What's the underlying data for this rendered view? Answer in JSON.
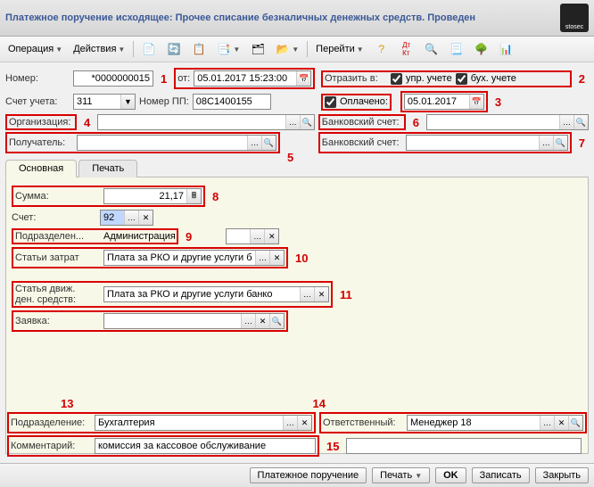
{
  "window": {
    "title": "Платежное поручение исходящее: Прочее списание безналичных денежных средств. Проведен"
  },
  "toolbar": {
    "operation_label": "Операция",
    "actions_label": "Действия",
    "goto_label": "Перейти"
  },
  "header": {
    "number_label": "Номер:",
    "number_value": "*0000000015",
    "date_label": "от:",
    "date_value": "05.01.2017 15:23:00",
    "reflect_label": "Отразить в:",
    "upr_label": "упр. учете",
    "bukh_label": "бух. учете",
    "account_label": "Счет учета:",
    "account_value": "311",
    "pp_label": "Номер ПП:",
    "pp_value": "08C1400155",
    "paid_label": "Оплачено:",
    "paid_value": "05.01.2017",
    "org_label": "Организация:",
    "org_value": "",
    "bank1_label": "Банковский счет:",
    "bank1_value": "",
    "recipient_label": "Получатель:",
    "recipient_value": "",
    "bank2_label": "Банковский счет:",
    "bank2_value": ""
  },
  "tabs": {
    "main_label": "Основная",
    "print_label": "Печать"
  },
  "main": {
    "sum_label": "Сумма:",
    "sum_value": "21,17",
    "acc_label": "Счет:",
    "acc_value": "92",
    "subdiv_label": "Подразделен...",
    "subdiv_value": "Администрация",
    "cost_label": "Статьи затрат",
    "cost_value": "Плата за РКО и другие услуги банко",
    "cash_move_label1": "Статья движ.",
    "cash_move_label2": "ден. средств:",
    "cash_move_value": "Плата за РКО и другие услуги банко",
    "request_label": "Заявка:",
    "request_value": ""
  },
  "bottom": {
    "subdiv_label": "Подразделение:",
    "subdiv_value": "Бухгалтерия",
    "resp_label": "Ответственный:",
    "resp_value": "Менеджер 18",
    "comment_label": "Комментарий:",
    "comment_value": "комиссия за кассовое обслуживание"
  },
  "footer": {
    "payorder_label": "Платежное поручение",
    "print_label": "Печать",
    "ok_label": "OK",
    "save_label": "Записать",
    "close_label": "Закрыть"
  },
  "annotations": {
    "a1": "1",
    "a2": "2",
    "a3": "3",
    "a4": "4",
    "a5": "5",
    "a6": "6",
    "a7": "7",
    "a8": "8",
    "a9": "9",
    "a10": "10",
    "a11": "11",
    "a13": "13",
    "a14": "14",
    "a15": "15"
  }
}
